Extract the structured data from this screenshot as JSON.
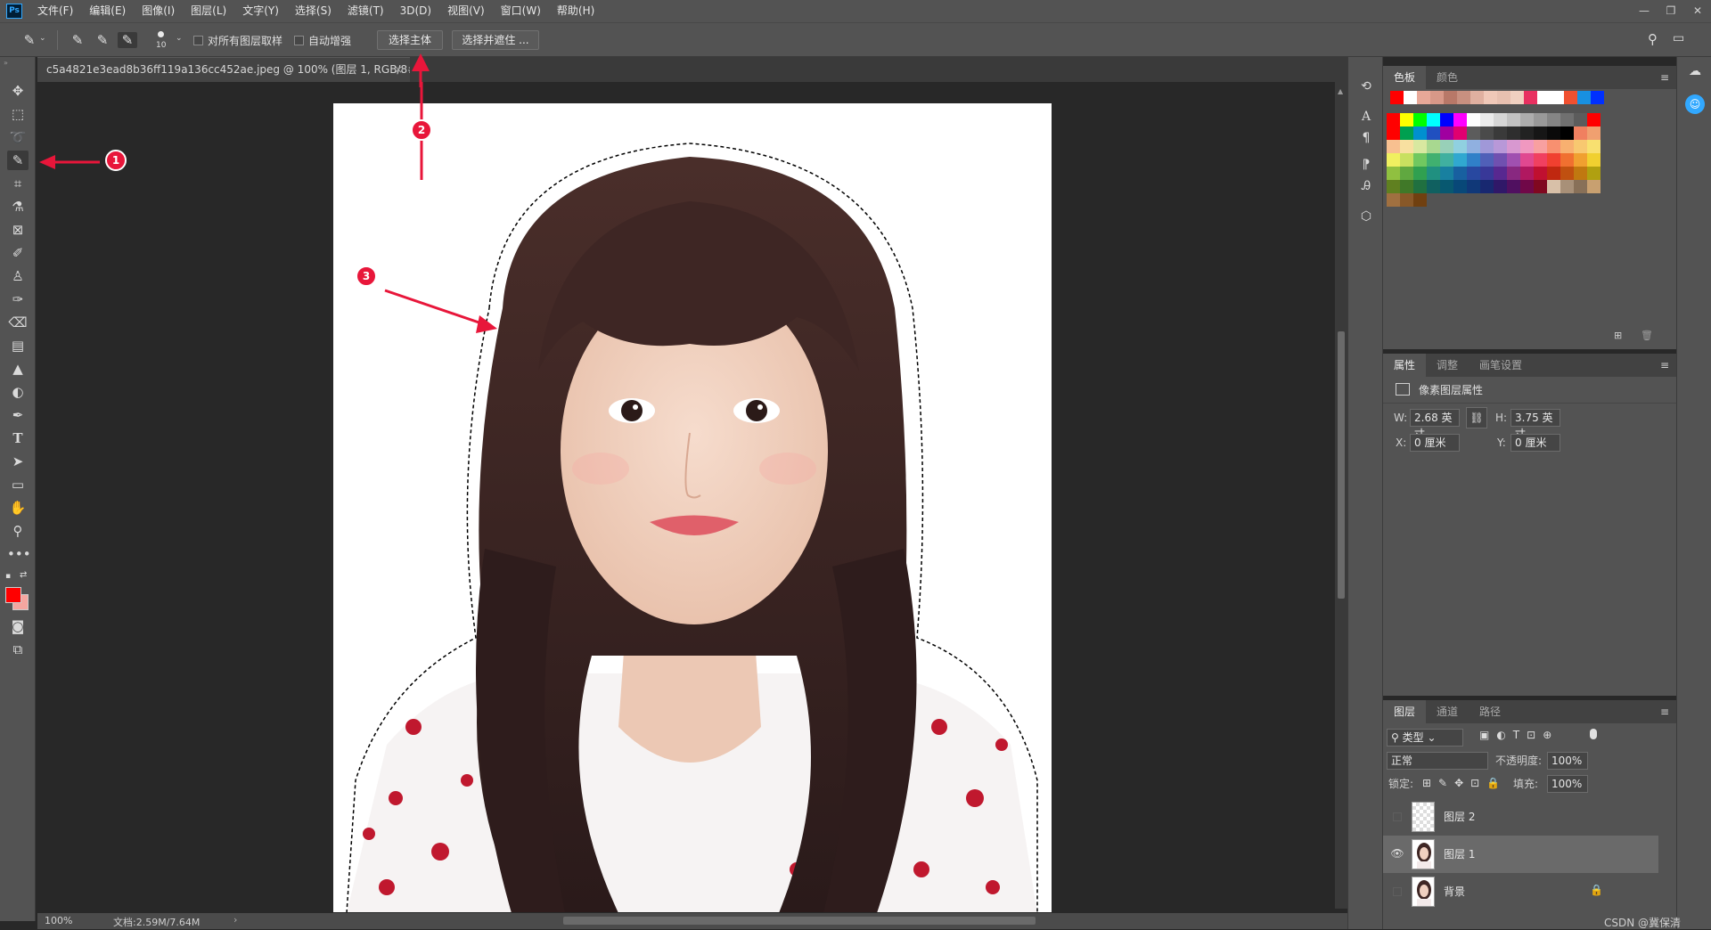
{
  "app": {
    "logo": "Ps"
  },
  "menu": [
    "文件(F)",
    "编辑(E)",
    "图像(I)",
    "图层(L)",
    "文字(Y)",
    "选择(S)",
    "滤镜(T)",
    "3D(D)",
    "视图(V)",
    "窗口(W)",
    "帮助(H)"
  ],
  "window_controls": [
    "minimize-icon",
    "restore-icon",
    "close-icon"
  ],
  "options": {
    "brush_size": "10",
    "sample_all_layers": "对所有图层取样",
    "auto_enhance": "自动增强",
    "select_subject": "选择主体",
    "select_and_mask": "选择并遮住 ..."
  },
  "document": {
    "tab_title": "c5a4821e3ead8b36ff119a136cc452ae.jpeg @ 100% (图层 1, RGB/8#) *",
    "zoom": "100%",
    "doc_size": "文档:2.59M/7.64M"
  },
  "annotations": [
    "1",
    "2",
    "3"
  ],
  "tools": [
    "move-tool",
    "marquee-tool",
    "lasso-tool",
    "quick-selection-tool",
    "crop-tool",
    "frame-tool",
    "eyedropper-tool",
    "healing-brush-tool",
    "brush-tool",
    "clone-stamp-tool",
    "history-brush-tool",
    "eraser-tool",
    "gradient-tool",
    "blur-tool",
    "dodge-tool",
    "pen-tool",
    "type-tool",
    "path-selection-tool",
    "rectangle-tool",
    "hand-tool",
    "zoom-tool",
    "more-tools"
  ],
  "colors": {
    "foreground": "#ff0000",
    "background": "#f4a6a0",
    "accent": "#31a8ff"
  },
  "swatches_panel": {
    "tabs": [
      "色板",
      "颜色"
    ],
    "recent": [
      "#ff0000",
      "#ffffff",
      "#e8a898",
      "#d89888",
      "#b87868",
      "#c89080",
      "#e0b0a0",
      "#f0c8b8",
      "#e8c0b0",
      "#f0d0c0",
      "#e83060",
      "#ffffff",
      "#ffffff",
      "#f05030",
      "#1890e0",
      "#0030ff"
    ],
    "rows": [
      [
        "#ff0000",
        "#ffff00",
        "#00ff00",
        "#00ffff",
        "#0000ff",
        "#ff00ff",
        "#ffffff",
        "#ebebeb",
        "#d6d6d6",
        "#c2c2c2",
        "#adadad",
        "#999999",
        "#858585",
        "#707070",
        "#5c5c5c",
        "#ff0000"
      ],
      [
        "#ff0000",
        "#00a050",
        "#0090d0",
        "#2050c0",
        "#a000a0",
        "#e00070",
        "#5c5c5c",
        "#4a4a4a",
        "#3a3a3a",
        "#2e2e2e",
        "#222222",
        "#161616",
        "#0a0a0a",
        "#000000",
        "#f08060",
        "#f0a070"
      ],
      [
        "#f8c090",
        "#f8e0a0",
        "#d8e8a0",
        "#a8d890",
        "#98d0b8",
        "#90d0e0",
        "#90b0e0",
        "#a098d8",
        "#b898d8",
        "#d898d0",
        "#f098c0",
        "#f8a0a0",
        "#f89070",
        "#f8b070",
        "#f8c870",
        "#f8e070"
      ],
      [
        "#f0f060",
        "#c8e060",
        "#70c860",
        "#40b070",
        "#40b0a0",
        "#30a8d0",
        "#3080c8",
        "#5060b8",
        "#7050b0",
        "#a050b0",
        "#e04890",
        "#f04060",
        "#f04030",
        "#f07030",
        "#f0a030",
        "#f0d030"
      ],
      [
        "#90c040",
        "#60a840",
        "#30a050",
        "#209080",
        "#1880a0",
        "#1860a0",
        "#2848a0",
        "#383898",
        "#582890",
        "#882880",
        "#b01860",
        "#c01030",
        "#c02810",
        "#c05010",
        "#c07810",
        "#b0a010"
      ],
      [
        "#608020",
        "#407828",
        "#207040",
        "#106060",
        "#085870",
        "#084878",
        "#103878",
        "#182870",
        "#301868",
        "#501060",
        "#700848",
        "#800820",
        "#d8c0a8",
        "#a89078",
        "#887058",
        "#c8a070"
      ],
      [
        "#a07040",
        "#885828",
        "#704010"
      ]
    ]
  },
  "properties_panel": {
    "tabs": [
      "属性",
      "调整",
      "画笔设置"
    ],
    "header": "像素图层属性",
    "w_label": "W:",
    "w_value": "2.68 英寸",
    "h_label": "H:",
    "h_value": "3.75 英寸",
    "x_label": "X:",
    "x_value": "0 厘米",
    "y_label": "Y:",
    "y_value": "0 厘米"
  },
  "layers_panel": {
    "tabs": [
      "图层",
      "通道",
      "路径"
    ],
    "filter_kind": "类型",
    "blend_mode": "正常",
    "opacity_label": "不透明度:",
    "opacity_value": "100%",
    "lock_label": "锁定:",
    "fill_label": "填充:",
    "fill_value": "100%",
    "layers": [
      {
        "name": "图层 2",
        "visible": false,
        "selected": false
      },
      {
        "name": "图层 1",
        "visible": true,
        "selected": true
      },
      {
        "name": "背景",
        "visible": false,
        "selected": false,
        "locked": true
      }
    ]
  },
  "watermark": "CSDN @冀保清"
}
